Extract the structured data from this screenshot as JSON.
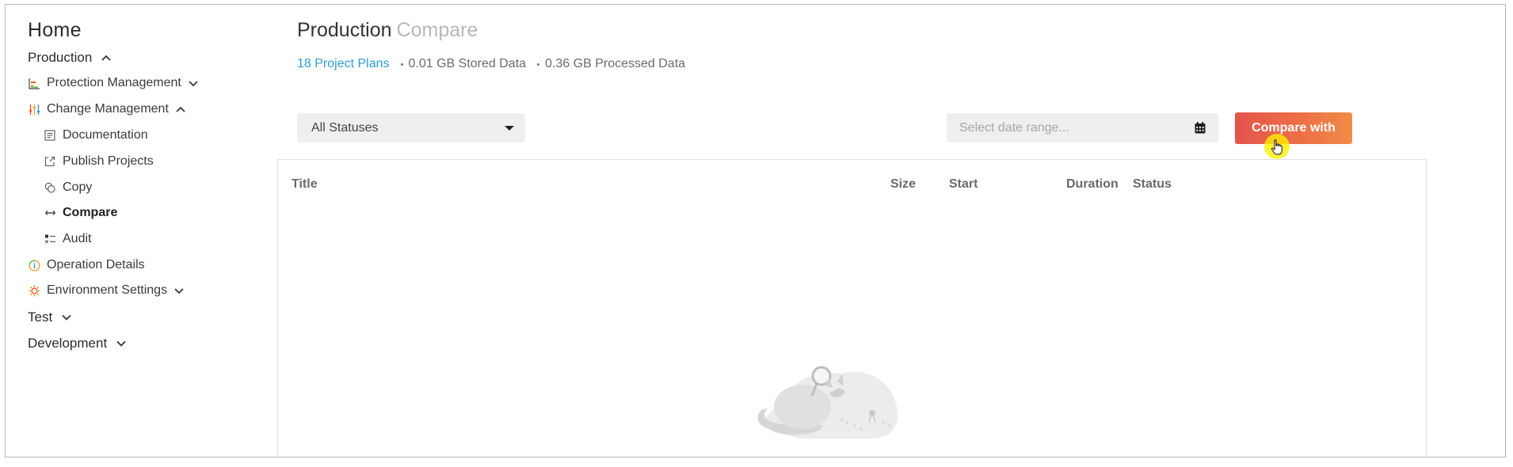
{
  "sidebar": {
    "home": "Home",
    "environments": {
      "production": "Production",
      "test": "Test",
      "development": "Development"
    },
    "items": {
      "protection_management": "Protection Management",
      "change_management": "Change Management",
      "documentation": "Documentation",
      "publish_projects": "Publish Projects",
      "copy": "Copy",
      "compare": "Compare",
      "audit": "Audit",
      "operation_details": "Operation Details",
      "environment_settings": "Environment Settings"
    }
  },
  "main": {
    "title": "Production",
    "subtitle": "Compare",
    "stats": {
      "project_plans": "18 Project Plans",
      "stored": "0.01 GB Stored Data",
      "processed": "0.36 GB Processed Data"
    },
    "status_filter": "All Statuses",
    "date_placeholder": "Select date range...",
    "compare_button": "Compare with",
    "table_headers": {
      "title": "Title",
      "size": "Size",
      "start": "Start",
      "duration": "Duration",
      "status": "Status"
    }
  },
  "colors": {
    "accent_link": "#2f9bd6",
    "button_gradient_start": "#e4544d",
    "button_gradient_end": "#f08b45",
    "cursor_highlight": "#fff000"
  }
}
